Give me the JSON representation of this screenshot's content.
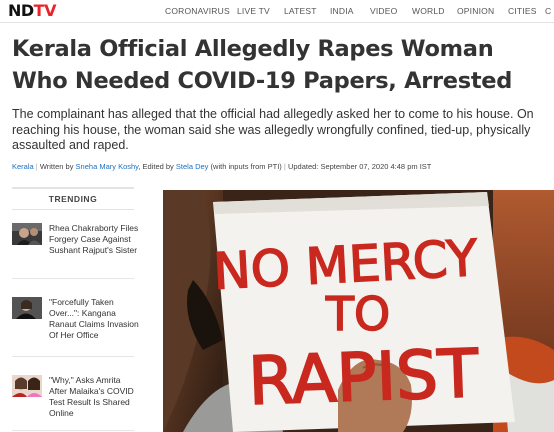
{
  "header": {
    "logo_part1": "ND",
    "logo_part2": "TV",
    "nav": [
      "CORONAVIRUS",
      "LIVE TV",
      "LATEST",
      "INDIA",
      "VIDEO",
      "WORLD",
      "OPINION",
      "CITIES",
      "C"
    ]
  },
  "article": {
    "headline": "Kerala Official Allegedly Rapes Woman Who Needed COVID-19 Papers, Arrested",
    "summary": "The complainant has alleged that the official had allegedly asked her to come to his house. On reaching his house, the woman said she was allegedly wrongfully confined, tied-up, physically assaulted and raped.",
    "byline": {
      "location": "Kerala",
      "written_by_prefix": "Written by",
      "author": "Sneha Mary Koshy",
      "edited_by_prefix": ", Edited by",
      "editor": "Stela Dey",
      "inputs_suffix": "(with inputs from PTI)",
      "updated": "Updated: September 07, 2020 4:48 pm IST"
    },
    "photo_sign": {
      "line1": "NO MERCY",
      "line2": "TO",
      "line3": "RAPIST",
      "ink_color": "#c8281e"
    }
  },
  "trending": {
    "title": "TRENDING",
    "items": [
      {
        "title": "Rhea Chakraborty Files Forgery Case Against Sushant Rajput's Sister"
      },
      {
        "title": "\"Forcefully Taken Over...\": Kangana Ranaut Claims Invasion Of Her Office"
      },
      {
        "title": "\"Why,\" Asks Amrita After Malaika's COVID Test Result Is Shared Online"
      }
    ]
  },
  "colors": {
    "brand_red": "#e8232a",
    "link_blue": "#1c6fc0"
  }
}
